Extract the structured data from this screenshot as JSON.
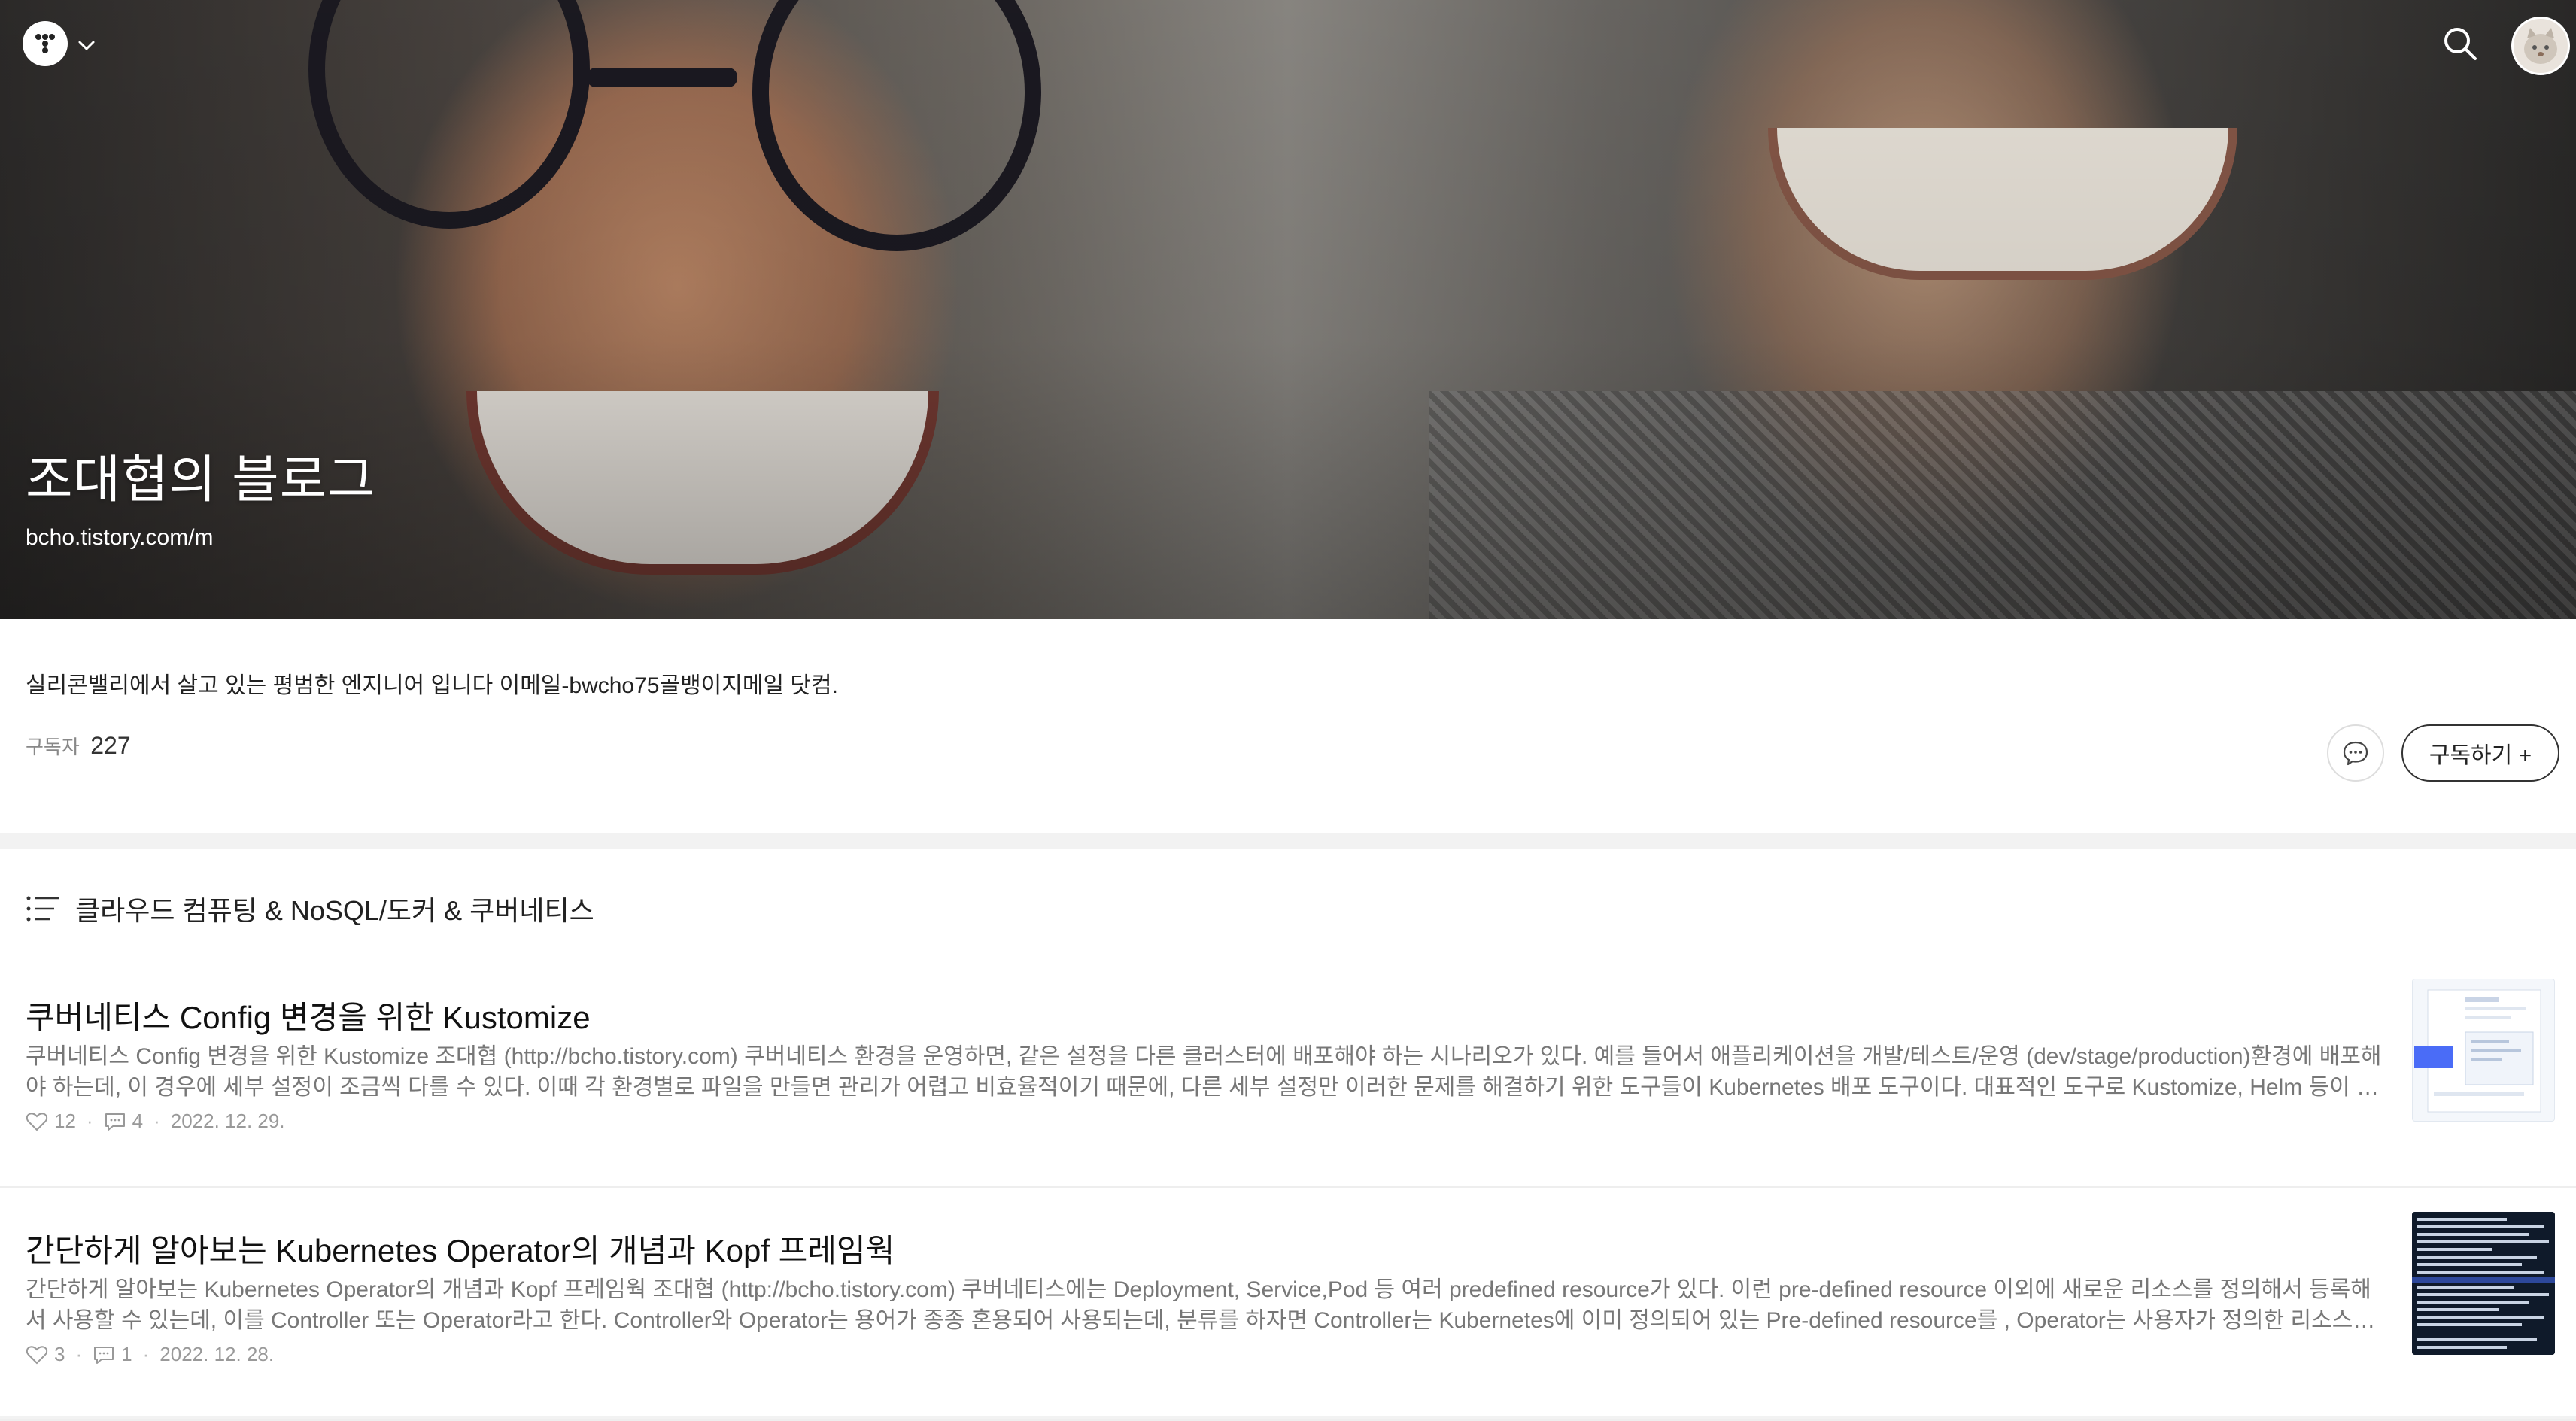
{
  "header": {
    "logo_icon": "tistory-logo-icon",
    "menu_icon": "chevron-down-icon",
    "search_icon": "search-icon",
    "avatar_icon": "profile-avatar"
  },
  "hero": {
    "title": "조대협의 블로그",
    "url": "bcho.tistory.com/m"
  },
  "profile": {
    "description": "실리콘밸리에서 살고 있는 평범한 엔지니어 입니다 이메일-bwcho75골뱅이지메일 닷컴.",
    "subscribers_label": "구독자",
    "subscribers_count": "227",
    "subscribe_label": "구독하기 +",
    "message_icon": "chat-bubble-icon"
  },
  "category": {
    "title": "클라우드 컴퓨팅 & NoSQL/도커 & 쿠버네티스",
    "icon": "list-icon"
  },
  "posts": [
    {
      "title": "쿠버네티스 Config 변경을 위한 Kustomize",
      "excerpt": "쿠버네티스 Config 변경을 위한 Kustomize 조대협 (http://bcho.tistory.com) 쿠버네티스 환경을 운영하면, 같은 설정을 다른 클러스터에 배포해야 하는 시나리오가 있다. 예를 들어서 애플리케이션을 개발/테스트/운영 (dev/stage/production)환경에 배포해야 하는데, 이 경우에 세부 설정이 조금씩 다를 수 있다. 이때 각 환경별로 파일을 만들면 관리가 어렵고 비효율적이기 때문에, 다른 세부 설정만 이러한 문제를 해결하기 위한 도구들이 Kubernetes 배포 도구이다. 대표적인 도구로 Kustomize, Helm 등이 있다.",
      "likes": "12",
      "comments": "4",
      "date": "2022. 12. 29."
    },
    {
      "title": "간단하게 알아보는 Kubernetes Operator의 개념과 Kopf 프레임웍",
      "excerpt": "간단하게 알아보는 Kubernetes Operator의 개념과 Kopf 프레임웍 조대협 (http://bcho.tistory.com) 쿠버네티스에는 Deployment, Service,Pod 등 여러 predefined resource가 있다. 이런 pre-defined resource 이외에 새로운 리소스를 정의해서 등록해서 사용할 수 있는데, 이를 Controller 또는 Operator라고 한다. Controller와 Operator는 용어가 종종 혼용되어 사용되는데, 분류를 하자면 Controller는 Kubernetes에 이미 정의되어 있는 Pre-defined resource를 , Operator는 사용자가 정의한 리소스를 관리한다.",
      "likes": "3",
      "comments": "1",
      "date": "2022. 12. 28."
    }
  ],
  "colors": {
    "accent_border": "#333333",
    "meta_text": "#999999",
    "excerpt_text": "#777777"
  }
}
